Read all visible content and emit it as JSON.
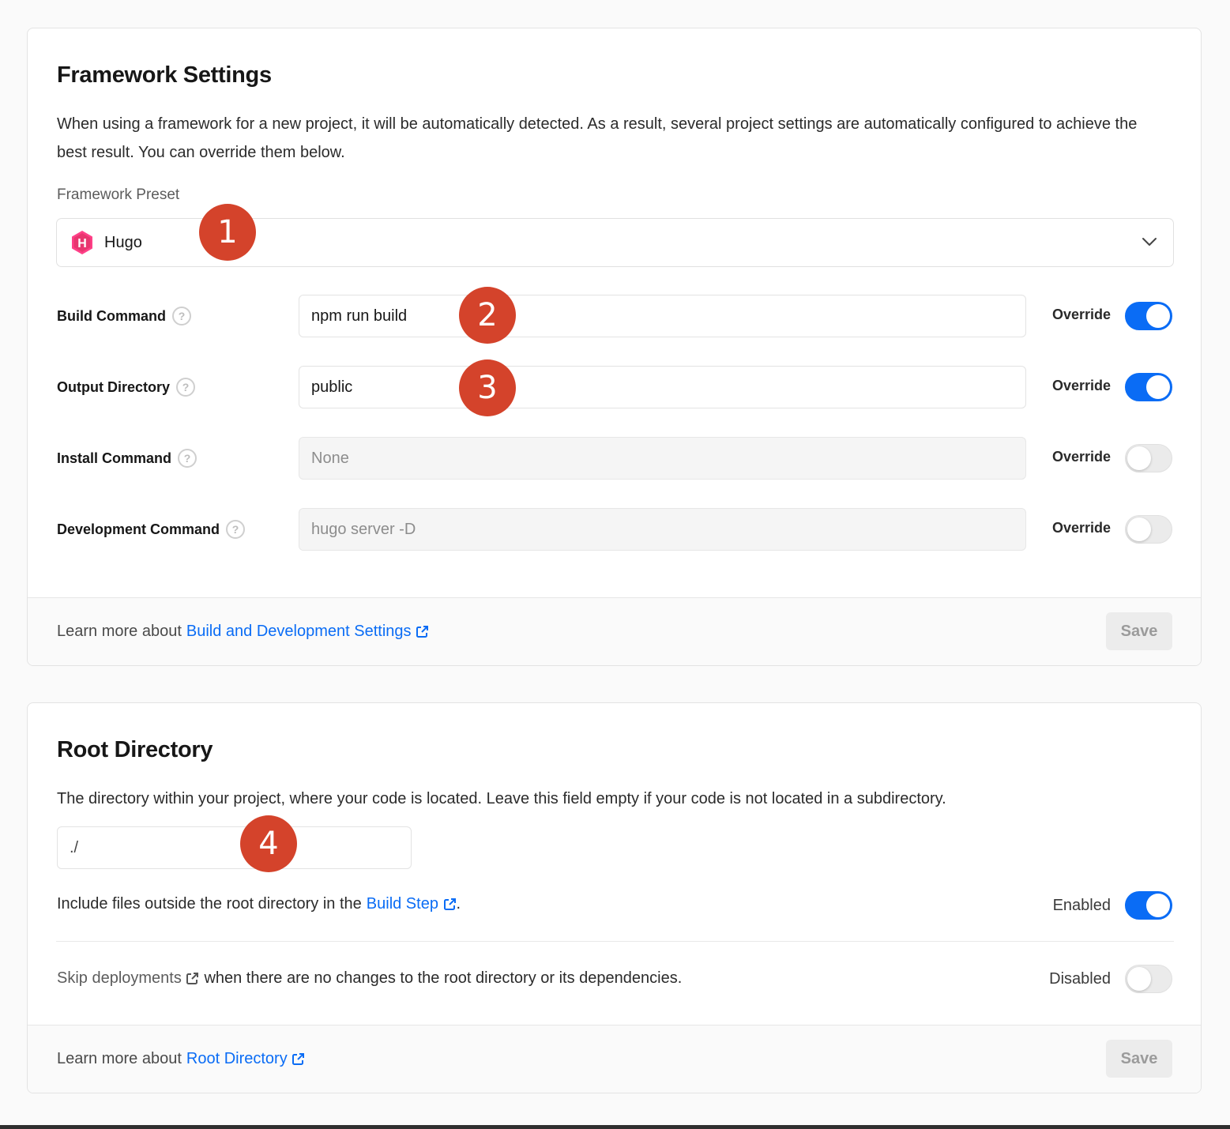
{
  "framework": {
    "title": "Framework Settings",
    "description": "When using a framework for a new project, it will be automatically detected. As a result, several project settings are automatically configured to achieve the best result. You can override them below.",
    "preset_label": "Framework Preset",
    "preset_value": "Hugo",
    "preset_icon": "hugo-logo",
    "rows": [
      {
        "label": "Build Command",
        "value": "npm run build",
        "override_label": "Override",
        "override": true
      },
      {
        "label": "Output Directory",
        "value": "public",
        "override_label": "Override",
        "override": true
      },
      {
        "label": "Install Command",
        "value": "None",
        "override_label": "Override",
        "override": false
      },
      {
        "label": "Development Command",
        "value": "hugo server -D",
        "override_label": "Override",
        "override": false
      }
    ],
    "footer_prefix": "Learn more about",
    "footer_link": "Build and Development Settings",
    "save_label": "Save"
  },
  "root": {
    "title": "Root Directory",
    "description": "The directory within your project, where your code is located. Leave this field empty if your code is not located in a subdirectory.",
    "input_value": "./",
    "include_prefix": "Include files outside the root directory in the",
    "include_link": "Build Step",
    "include_suffix": ".",
    "include_state": "Enabled",
    "include_on": true,
    "skip_link": "Skip deployments",
    "skip_suffix": "when there are no changes to the root directory or its dependencies.",
    "skip_state": "Disabled",
    "skip_on": false,
    "footer_prefix": "Learn more about",
    "footer_link": "Root Directory",
    "save_label": "Save"
  },
  "annotations": [
    "1",
    "2",
    "3",
    "4"
  ],
  "colors": {
    "accent": "#0a6cf5",
    "badge": "#d4432b",
    "hugo": "#ff4088"
  }
}
